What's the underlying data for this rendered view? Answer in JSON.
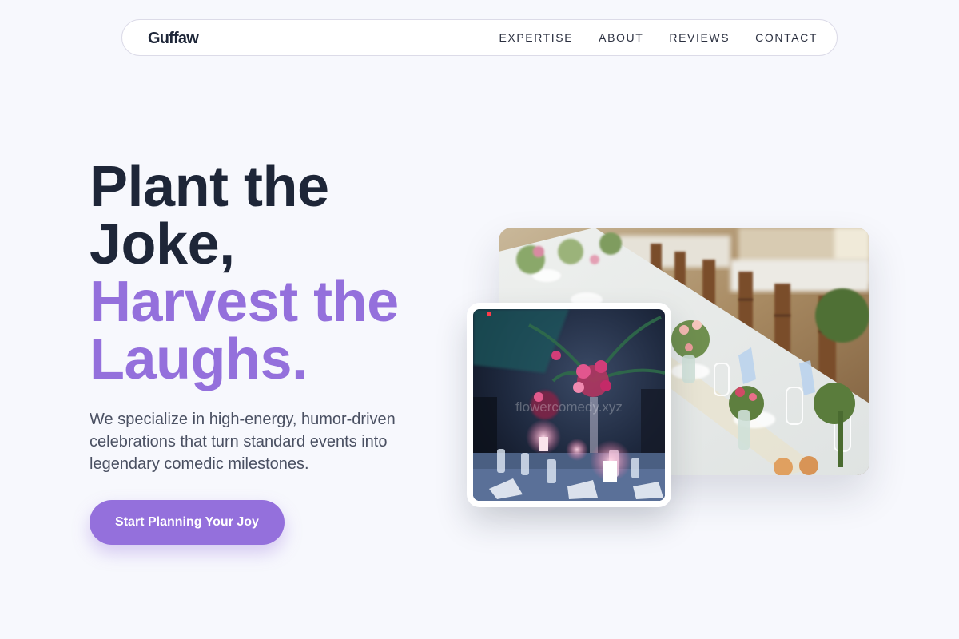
{
  "nav": {
    "logo": "Guffaw",
    "links": [
      "EXPERTISE",
      "ABOUT",
      "REVIEWS",
      "CONTACT"
    ]
  },
  "hero": {
    "title_line1": "Plant the",
    "title_line2": "Joke,",
    "title_line3": "Harvest the",
    "title_line4": "Laughs.",
    "subtitle": "We specialize in high-energy, humor-driven celebrations that turn standard events into legendary comedic milestones.",
    "cta_label": "Start Planning Your Joy"
  },
  "images": {
    "small_watermark": "flowercomedy.xyz"
  },
  "colors": {
    "accent": "#9470dc",
    "heading": "#1e2638",
    "body_text": "#4a5062",
    "background": "#f7f8fd"
  }
}
